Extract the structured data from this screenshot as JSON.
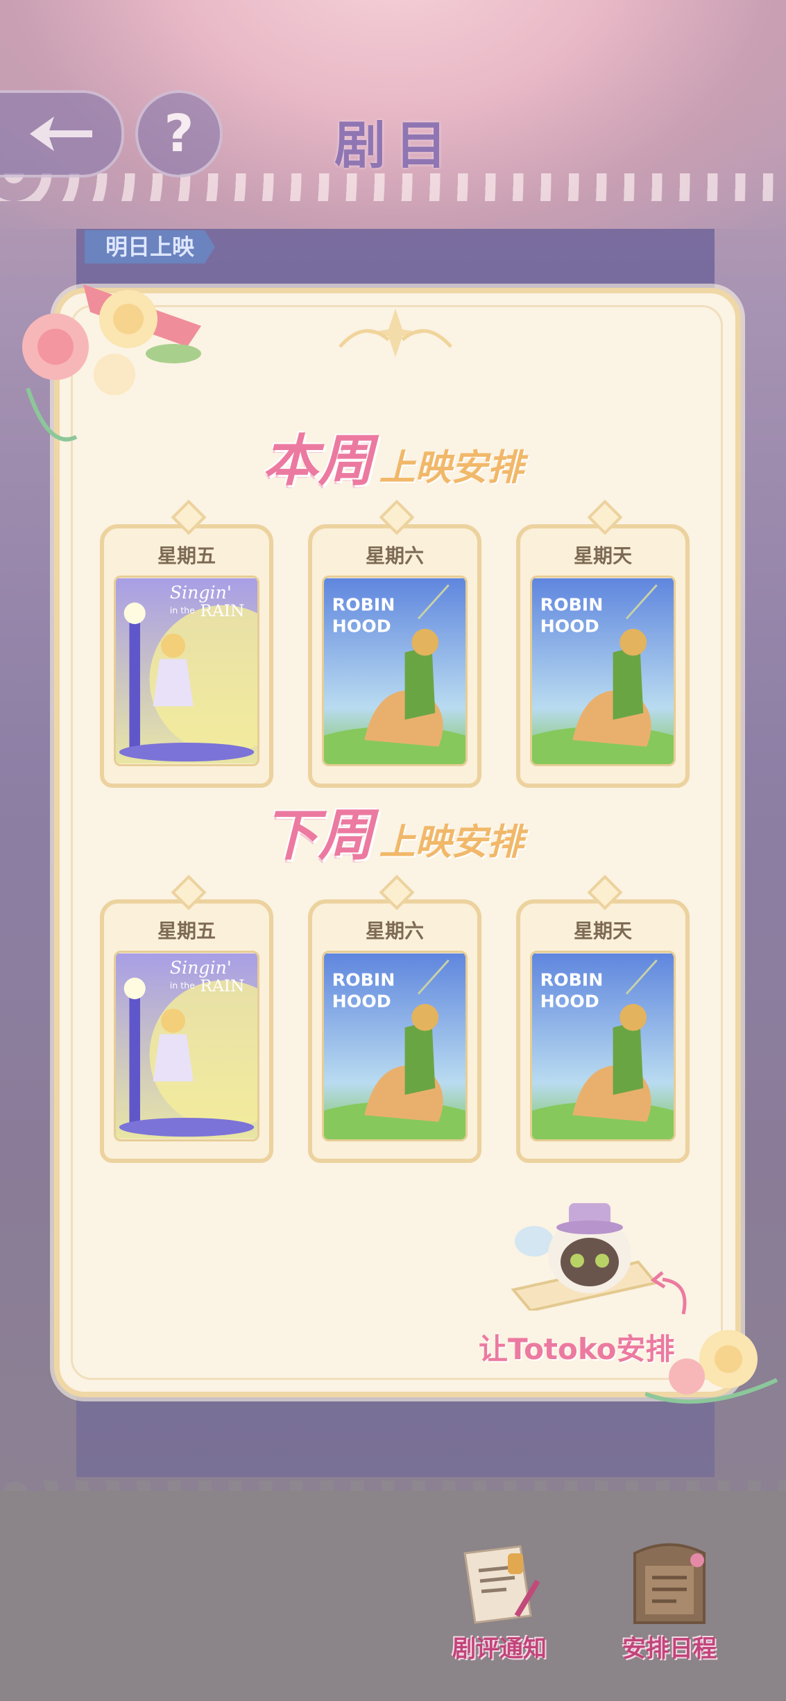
{
  "header": {
    "title": "剧目",
    "tomorrow_tag": "明日上映"
  },
  "this_week": {
    "title_big": "本周",
    "title_small": "上映安排",
    "slots": [
      {
        "day": "星期五",
        "poster": "singin-in-the-rain"
      },
      {
        "day": "星期六",
        "poster": "robin-hood"
      },
      {
        "day": "星期天",
        "poster": "robin-hood"
      }
    ]
  },
  "next_week": {
    "title_big": "下周",
    "title_small": "上映安排",
    "slots": [
      {
        "day": "星期五",
        "poster": "singin-in-the-rain"
      },
      {
        "day": "星期六",
        "poster": "robin-hood"
      },
      {
        "day": "星期天",
        "poster": "robin-hood"
      }
    ]
  },
  "posters": {
    "singin": {
      "line1": "Singin'",
      "line2": "in the",
      "line3": "RAIN"
    },
    "robin": {
      "line1": "ROBIN",
      "line2": "HOOD"
    }
  },
  "totoko": {
    "label": "让Totoko安排"
  },
  "dock": {
    "review_label": "剧评通知",
    "schedule_label": "安排日程"
  },
  "colors": {
    "accent_pink": "#ec7aa0",
    "accent_gold": "#f1b86a",
    "card_bg": "#fbf3e3",
    "title_purple": "#8f76b3"
  }
}
